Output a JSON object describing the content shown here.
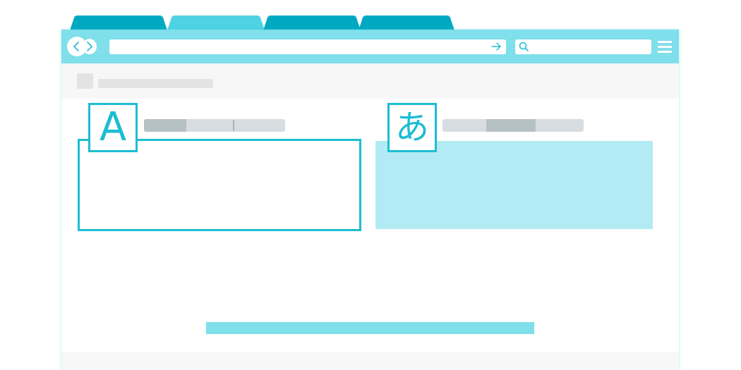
{
  "tabs": [
    {
      "label": "",
      "active": false
    },
    {
      "label": "",
      "active": true
    },
    {
      "label": "",
      "active": false
    },
    {
      "label": "",
      "active": false
    }
  ],
  "toolbar": {
    "back_icon": "chevron-left-icon",
    "forward_icon": "chevron-right-icon",
    "address_value": "",
    "go_icon": "arrow-right-icon",
    "search_value": "",
    "search_icon": "magnifier-icon",
    "menu_icon": "hamburger-icon"
  },
  "translator": {
    "source": {
      "glyph": "A"
    },
    "target": {
      "glyph": "あ"
    },
    "source_text": "",
    "target_text": ""
  },
  "colors": {
    "accent": "#1cbdd3",
    "toolbar": "#7fdfea",
    "tab_dark": "#00a9c2",
    "tab_light": "#4fd2e3",
    "target_fill": "#b2ebf3",
    "placeholder_gray": "#d7dde0"
  }
}
